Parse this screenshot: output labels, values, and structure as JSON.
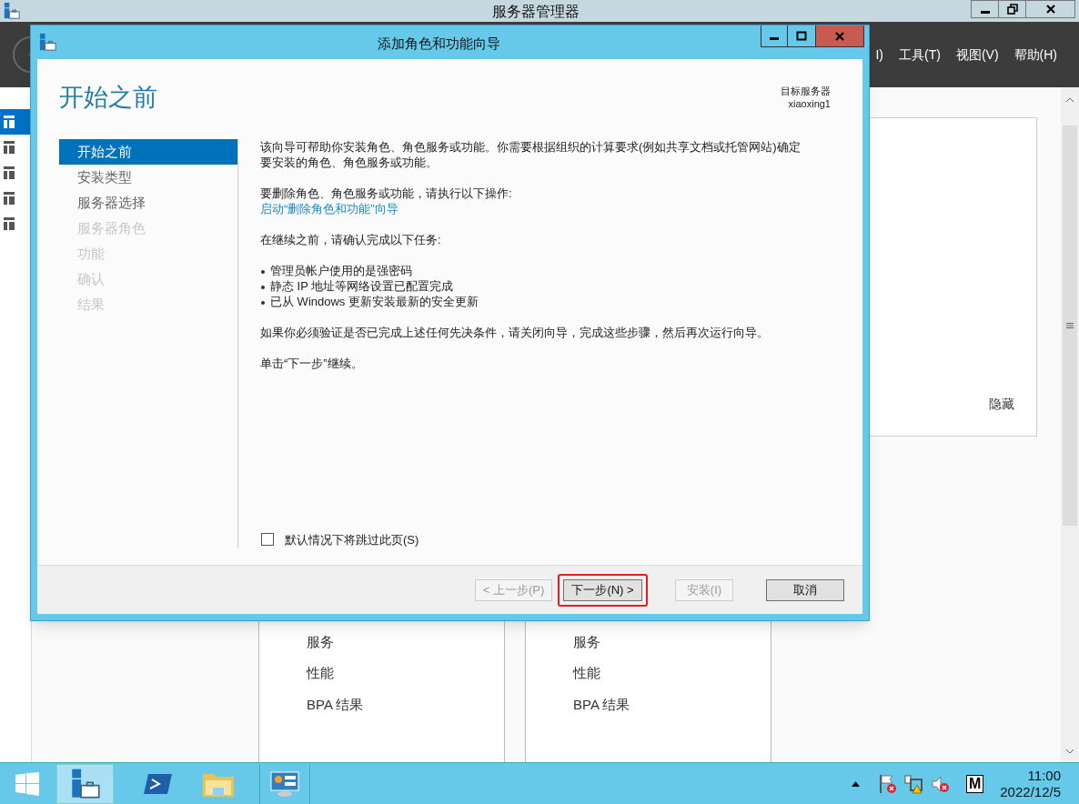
{
  "main_window": {
    "title": "服务器管理器",
    "menu": [
      "I)",
      "工具(T)",
      "视图(V)",
      "帮助(H)"
    ],
    "welcome_tile": {
      "hide_label": "隐藏"
    },
    "tiles": [
      {
        "items": [
          "服务",
          "性能",
          "BPA 结果"
        ]
      },
      {
        "items": [
          "服务",
          "性能",
          "BPA 结果"
        ]
      }
    ]
  },
  "dialog": {
    "title": "添加角色和功能向导",
    "heading": "开始之前",
    "target_label": "目标服务器",
    "target_name": "xiaoxing1",
    "steps": [
      {
        "label": "开始之前",
        "selected": true,
        "disabled": false
      },
      {
        "label": "安装类型",
        "selected": false,
        "disabled": false
      },
      {
        "label": "服务器选择",
        "selected": false,
        "disabled": false
      },
      {
        "label": "服务器角色",
        "selected": false,
        "disabled": true
      },
      {
        "label": "功能",
        "selected": false,
        "disabled": true
      },
      {
        "label": "确认",
        "selected": false,
        "disabled": true
      },
      {
        "label": "结果",
        "selected": false,
        "disabled": true
      }
    ],
    "content": [
      {
        "kind": "paragraph",
        "lines": [
          {
            "kind": "text",
            "text": "该向导可帮助你安装角色、角色服务或功能。你需要根据组织的计算要求(例如共享文档或托管网站)确定要安装的角色、角色服务或功能。"
          }
        ]
      },
      {
        "kind": "paragraph",
        "lines": [
          {
            "kind": "text",
            "text": "要删除角色、角色服务或功能，请执行以下操作:"
          },
          {
            "kind": "link",
            "text": "启动“删除角色和功能”向导"
          }
        ]
      },
      {
        "kind": "paragraph",
        "lines": [
          {
            "kind": "text",
            "text": "在继续之前，请确认完成以下任务:"
          }
        ]
      },
      {
        "kind": "bullets",
        "items": [
          "管理员帐户使用的是强密码",
          "静态 IP 地址等网络设置已配置完成",
          "已从 Windows 更新安装最新的安全更新"
        ]
      },
      {
        "kind": "paragraph",
        "lines": [
          {
            "kind": "text",
            "text": "如果你必须验证是否已完成上述任何先决条件，请关闭向导，完成这些步骤，然后再次运行向导。"
          }
        ]
      },
      {
        "kind": "paragraph",
        "lines": [
          {
            "kind": "text",
            "text": "单击“下一步”继续。"
          }
        ]
      }
    ],
    "skip_checkbox": {
      "label": "默认情况下将跳过此页(S)",
      "checked": false
    },
    "buttons": [
      {
        "label": "< 上一步(P)",
        "disabled": true,
        "highlighted": false
      },
      {
        "label": "下一步(N) >",
        "disabled": false,
        "highlighted": true
      },
      {
        "label": "安装(I)",
        "disabled": true,
        "highlighted": false
      },
      {
        "label": "取消",
        "disabled": false,
        "highlighted": false
      }
    ]
  },
  "taskbar": {
    "ime_label": "M",
    "clock_time": "11:00",
    "clock_date": "2022/12/5"
  }
}
